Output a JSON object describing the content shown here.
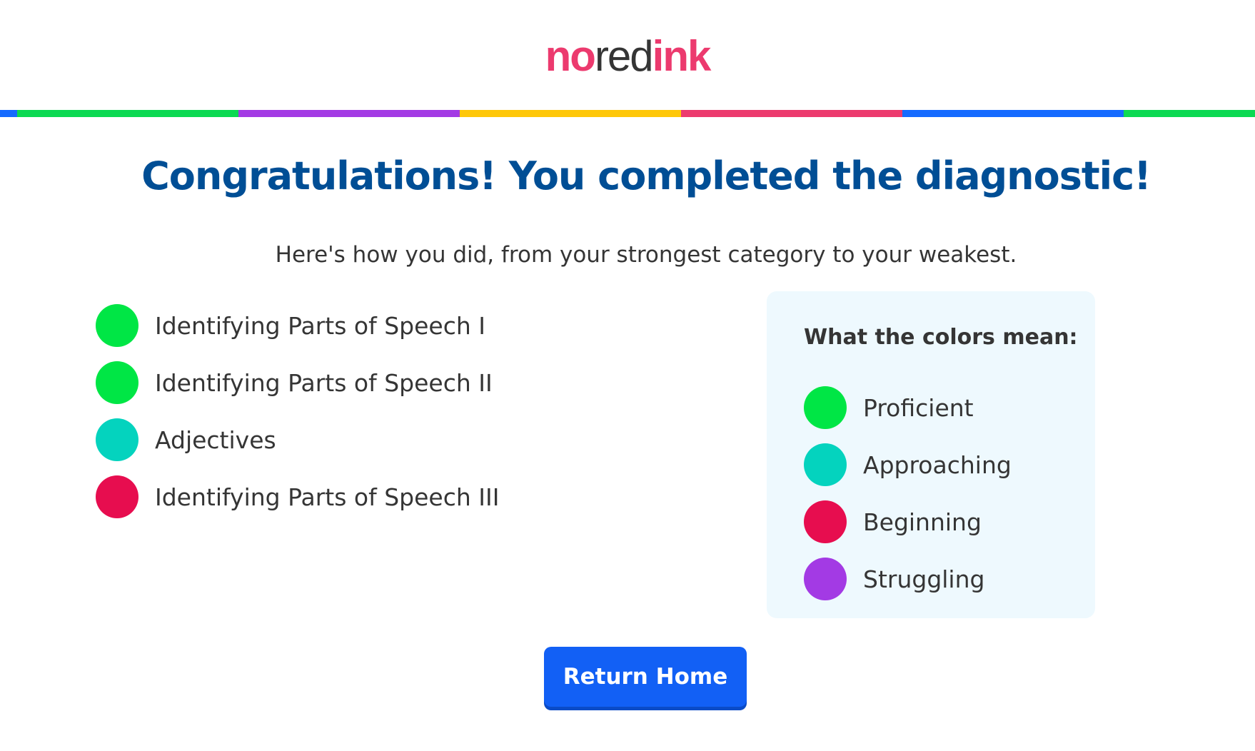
{
  "logo": {
    "part1": "no",
    "part2": "red",
    "part3": "ink"
  },
  "rainbow": [
    "#146aff",
    "#0cd952",
    "#a33ae4",
    "#fec709",
    "#ec3a6e",
    "#146aff",
    "#0cd952"
  ],
  "heading": "Congratulations! You completed the diagnostic!",
  "subheading": "Here's how you did, from your strongest category to your weakest.",
  "results": [
    {
      "label": "Identifying Parts of Speech I",
      "level": "Proficient",
      "color": "#00e645"
    },
    {
      "label": "Identifying Parts of Speech II",
      "level": "Proficient",
      "color": "#00e645"
    },
    {
      "label": "Adjectives",
      "level": "Approaching",
      "color": "#04d3be"
    },
    {
      "label": "Identifying Parts of Speech III",
      "level": "Beginning",
      "color": "#e70d4f"
    }
  ],
  "legend": {
    "title": "What the colors mean:",
    "items": [
      {
        "label": "Proficient",
        "color": "#00e645"
      },
      {
        "label": "Approaching",
        "color": "#04d3be"
      },
      {
        "label": "Beginning",
        "color": "#e70d4f"
      },
      {
        "label": "Struggling",
        "color": "#a33ae4"
      }
    ]
  },
  "button": {
    "label": "Return Home",
    "color": "#1260f5"
  }
}
